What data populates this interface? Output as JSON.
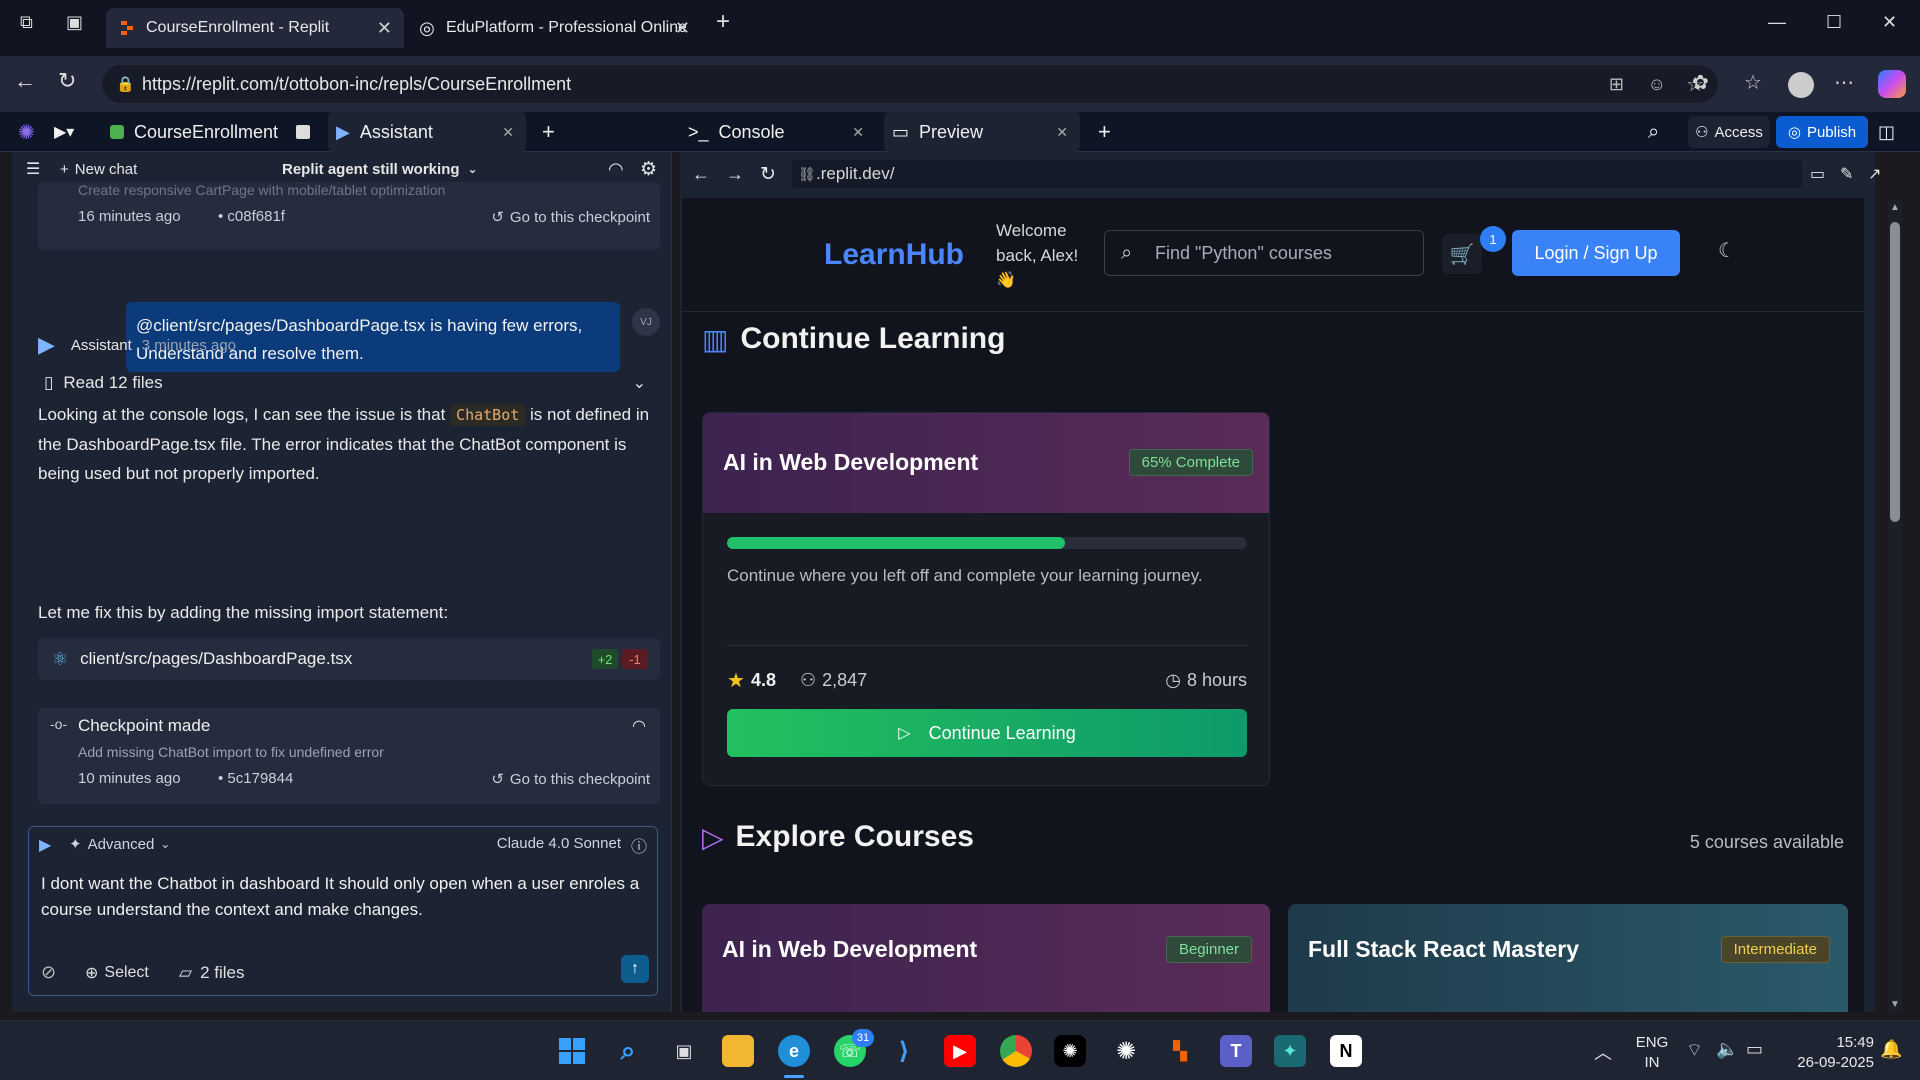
{
  "browser": {
    "tabs": [
      {
        "title": "CourseEnrollment - Replit",
        "active": true
      },
      {
        "title": "EduPlatform - Professional Online",
        "active": false
      }
    ],
    "url": "https://replit.com/t/ottobon-inc/repls/CourseEnrollment"
  },
  "replit": {
    "project_name": "CourseEnrollment",
    "assistant_tab": "Assistant",
    "console_tab": "Console",
    "preview_tab": "Preview",
    "access_label": "Access",
    "publish_label": "Publish"
  },
  "chat": {
    "new_chat": "New chat",
    "status": "Replit agent still working",
    "checkpoint1": {
      "desc": "Create responsive CartPage with mobile/tablet optimization",
      "time": "16 minutes ago",
      "hash": "• c08f681f",
      "goto": "Go to this checkpoint"
    },
    "user_message": "@client/src/pages/DashboardPage.tsx is having few errors, Understand and resolve them.",
    "user_initials": "VJ",
    "assistant_name": "Assistant",
    "assistant_time": "3 minutes ago",
    "read_files": "Read 12 files",
    "para1_pre": "Looking at the console logs, I can see the issue is that",
    "para1_code": "ChatBot",
    "para1_post": "is not defined in the DashboardPage.tsx file. The error indicates that the ChatBot component is being used but not properly imported.",
    "para2": "Let me fix this by adding the missing import statement:",
    "file_path": "client/src/pages/DashboardPage.tsx",
    "added": "+2",
    "removed": "-1",
    "checkpoint2": {
      "title": "Checkpoint made",
      "desc": "Add missing ChatBot import to fix undefined error",
      "time": "10 minutes ago",
      "hash": "• 5c179844",
      "goto": "Go to this checkpoint"
    }
  },
  "composer": {
    "mode": "Advanced",
    "model": "Claude 4.0 Sonnet",
    "text": "I dont want the Chatbot in dashboard It should only open when a user enroles a course understand the context and make changes.",
    "select_label": "Select",
    "files_label": "2 files"
  },
  "preview": {
    "url": ".replit.dev/",
    "site": {
      "logo": "LearnHub",
      "welcome": "Welcome back, Alex!",
      "wave": "👋",
      "search_placeholder": "Find \"Python\" courses",
      "cart_count": "1",
      "login": "Login / Sign Up",
      "continue_title": "Continue Learning",
      "card": {
        "title": "AI in Web Development",
        "badge": "65% Complete",
        "progress": 0.65,
        "desc": "Continue where you left off and complete your learning journey.",
        "rating": "4.8",
        "students": "2,847",
        "hours": "8 hours",
        "button": "Continue Learning"
      },
      "explore_title": "Explore Courses",
      "courses_available": "5 courses available",
      "explore_cards": [
        {
          "title": "AI in Web Development",
          "level": "Beginner"
        },
        {
          "title": "Full Stack React Mastery",
          "level": "Intermediate"
        }
      ]
    }
  },
  "taskbar": {
    "whatsapp_count": "31",
    "lang_top": "ENG",
    "lang_bottom": "IN",
    "time": "15:49",
    "date": "26-09-2025"
  },
  "colors": {
    "accent": "#0b5cd1",
    "logo": "#4a86ff",
    "progress": "#21c06a"
  }
}
